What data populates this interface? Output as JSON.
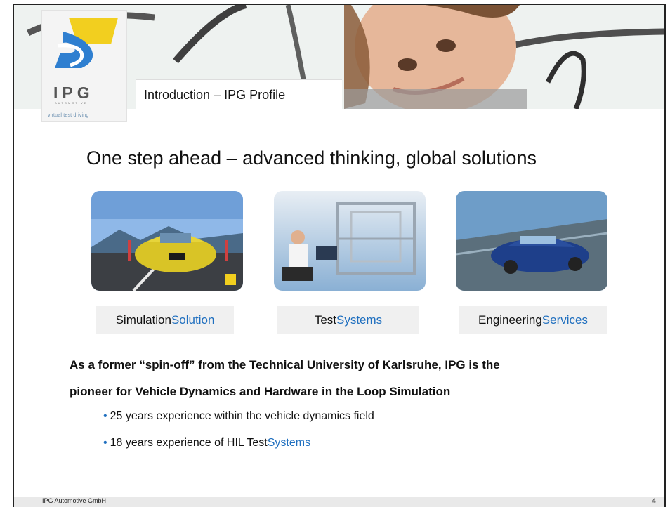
{
  "header": {
    "section_title": "Introduction – IPG Profile",
    "logo_text": "IPG",
    "logo_subtext": "AUTOMOTIVE",
    "logo_tagline": "virtual test driving"
  },
  "headline": "One step ahead – advanced thinking, global solutions",
  "cards": [
    {
      "label_black": "Simulation",
      "label_blue": "Solution",
      "image": "simulation-car-render"
    },
    {
      "label_black": "Test",
      "label_blue": "Systems",
      "image": "test-bench-operator"
    },
    {
      "label_black": "Engineering",
      "label_blue": "Services",
      "image": "car-on-road"
    }
  ],
  "body": {
    "paragraph_line1": "As a former “spin-off” from the Technical University of Karlsruhe, IPG is the",
    "paragraph_line2": "pioneer for Vehicle Dynamics and Hardware in the Loop Simulation",
    "bullets": [
      {
        "text": "25 years experience within the vehicle dynamics field",
        "blue_suffix": ""
      },
      {
        "text": "18 years experience of HIL Test",
        "blue_suffix": "Systems"
      }
    ],
    "bullet_glyph": "•"
  },
  "footer": {
    "company": "IPG Automotive GmbH",
    "page_number": "4"
  },
  "colors": {
    "accent_blue": "#1f6fbf",
    "logo_yellow": "#f2cf1f",
    "logo_blue": "#2f7fd0"
  }
}
